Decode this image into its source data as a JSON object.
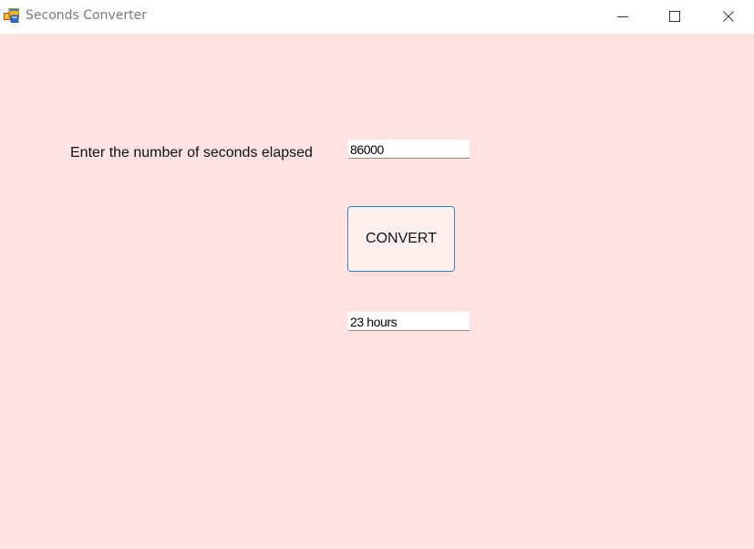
{
  "window": {
    "title": "Seconds Converter",
    "icon": "windows-forms-app-icon",
    "controls": {
      "minimize": "minimize-icon",
      "maximize": "maximize-icon",
      "close": "close-icon"
    }
  },
  "form": {
    "prompt_label": "Enter the number of seconds elapsed",
    "seconds_value": "86000",
    "convert_label": "CONVERT",
    "result_value": "23 hours"
  },
  "colors": {
    "form_background": "#ffe3e0",
    "button_background": "#fff2ee",
    "button_border": "#3c7fd8"
  }
}
